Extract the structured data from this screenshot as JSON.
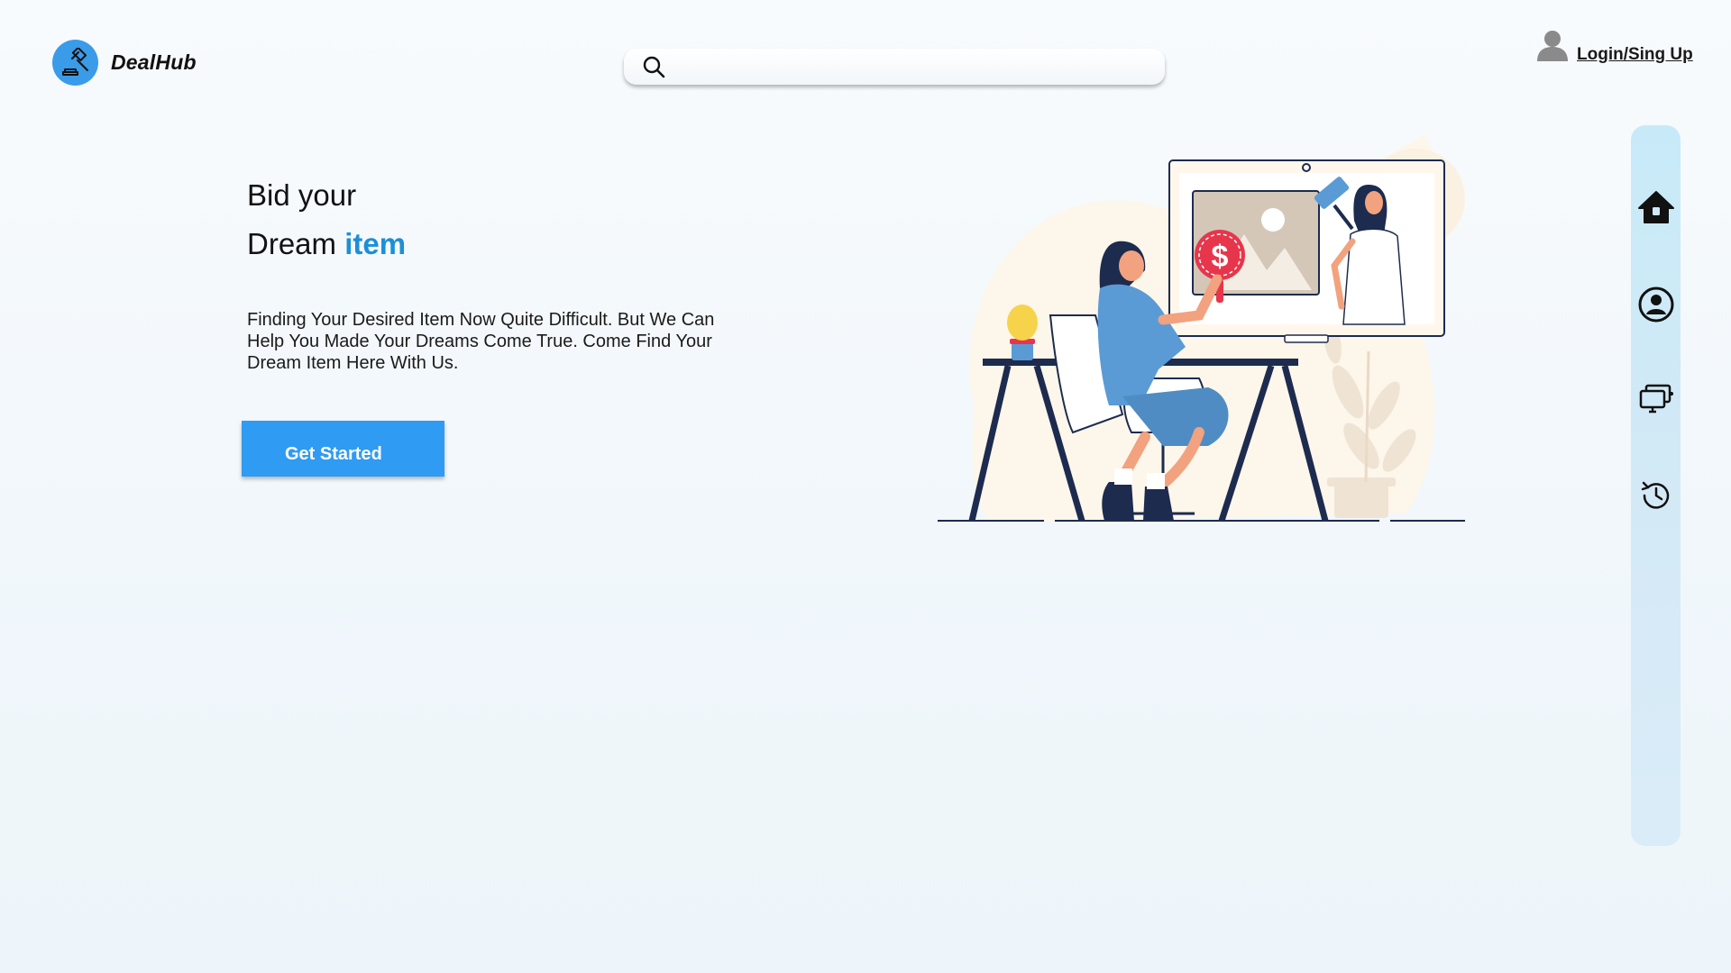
{
  "brand": {
    "name": "DealHub",
    "logo_icon": "gavel-icon",
    "logo_color": "#3a9be9"
  },
  "search": {
    "placeholder": "",
    "value": "",
    "icon": "search-icon"
  },
  "account": {
    "label": "Login/Sing Up",
    "icon": "user-icon"
  },
  "hero": {
    "title_line1": "Bid your",
    "title_line2_plain": "Dream",
    "title_line2_accent": "item",
    "accent_color": "#1c8fd6",
    "description": "Finding Your Desired Item Now Quite Difficult. But We Can Help You Made Your Dreams Come True. Come Find Your Dream Item Here With Us.",
    "cta_label": "Get Started",
    "cta_color": "#2f9bf2",
    "price_symbol": "$"
  },
  "rail": {
    "background": "#cfe9f7",
    "items": [
      {
        "icon": "home-icon"
      },
      {
        "icon": "profile-icon"
      },
      {
        "icon": "auctions-icon"
      },
      {
        "icon": "history-icon"
      }
    ]
  }
}
